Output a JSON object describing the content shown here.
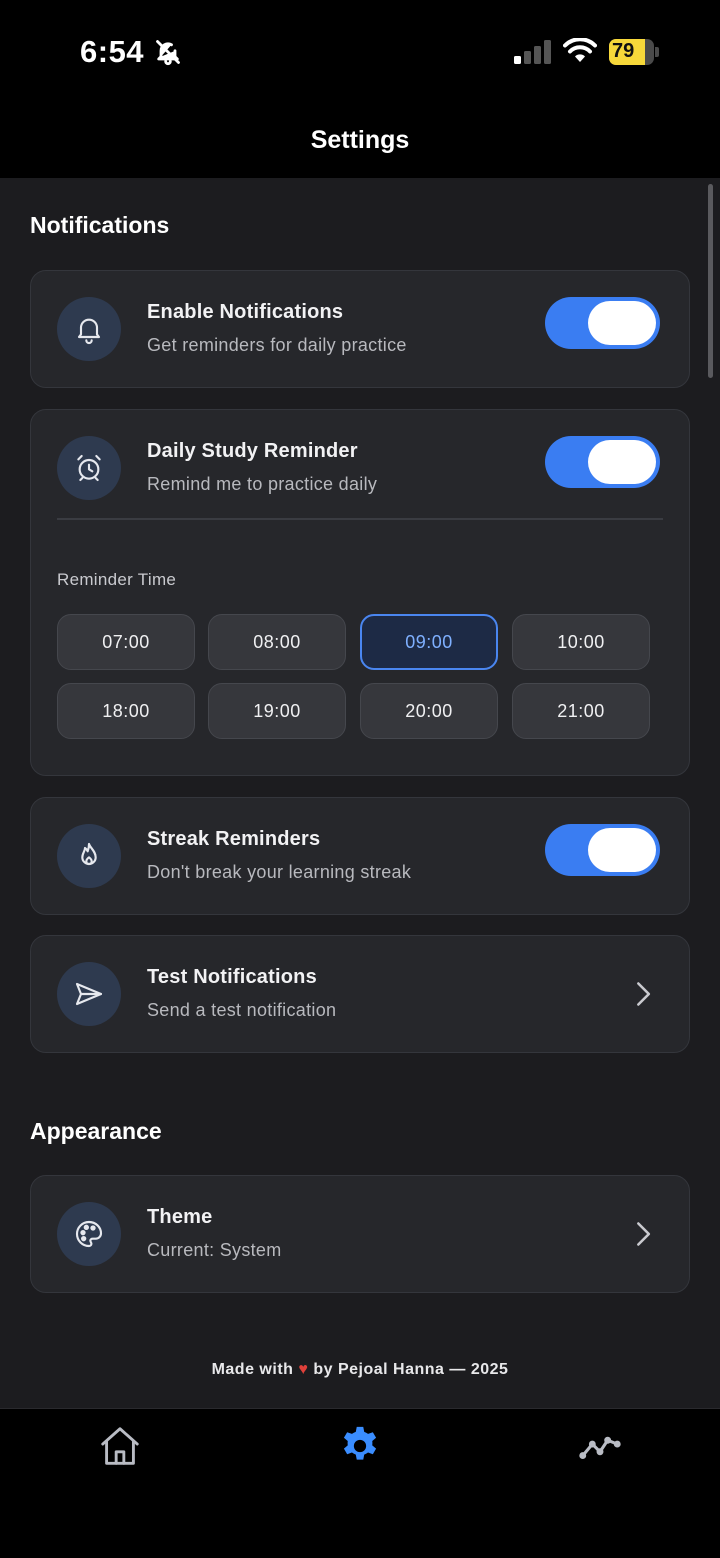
{
  "status": {
    "time": "6:54",
    "battery": "79",
    "battery_level": 0.79
  },
  "header": {
    "title": "Settings"
  },
  "notifications": {
    "section_title": "Notifications",
    "enable": {
      "title": "Enable Notifications",
      "subtitle": "Get reminders for daily practice",
      "on": true
    },
    "daily": {
      "title": "Daily Study Reminder",
      "subtitle": "Remind me to practice daily",
      "on": true,
      "time_label": "Reminder Time",
      "times": [
        "07:00",
        "08:00",
        "09:00",
        "10:00",
        "18:00",
        "19:00",
        "20:00",
        "21:00"
      ],
      "selected": "09:00"
    },
    "streak": {
      "title": "Streak Reminders",
      "subtitle": "Don't break your learning streak",
      "on": true
    },
    "test": {
      "title": "Test Notifications",
      "subtitle": "Send a test notification"
    }
  },
  "appearance": {
    "section_title": "Appearance",
    "theme": {
      "title": "Theme",
      "subtitle": "Current: System"
    }
  },
  "footer": {
    "prefix": "Made with",
    "heart": "♥",
    "suffix": "by Pejoal Hanna — 2025"
  },
  "tabbar": {
    "items": [
      "home-icon",
      "settings-gear-icon",
      "stats-line-icon"
    ],
    "active": "settings-gear-icon"
  },
  "colors": {
    "accent": "#3a7df2",
    "background": "#1c1c1f",
    "card": "#26272b",
    "heart": "#e0403a",
    "battery": "#f7d83a"
  }
}
